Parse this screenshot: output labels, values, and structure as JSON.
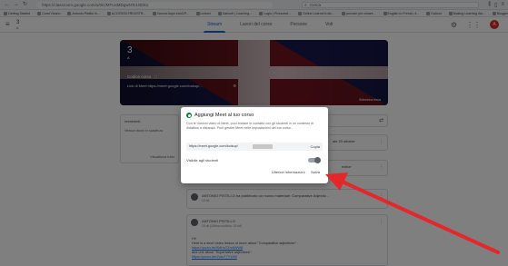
{
  "browser": {
    "url": "https://classroom.google.com/u/0/c/MTUxMDgwNTc1ODk1",
    "search_placeholder": "Cerca",
    "bookmarks": [
      "Getting Started",
      "Corsi Vicario",
      "Antonio Pistillo in...",
      "ACCESSO REGISTR...",
      "Nuova Aspo eduGP...",
      "Lezioni",
      "Kahoot! | Learning...",
      "Login | Pronuncit...",
      "Online Learner's dic...",
      "provare per creare...",
      "English to French, it...",
      "Kahoot",
      "Making Learning Aw...",
      "Blogger: Prof. Pisti..."
    ]
  },
  "classroom": {
    "menu_icon": "hamburger-menu-icon",
    "course_num": "3",
    "course_sub": "A",
    "tabs": [
      "Stream",
      "Lavori del corso",
      "Persone",
      "Voti"
    ],
    "active_tab": "Stream",
    "avatar_letter": "A"
  },
  "banner": {
    "title": "3",
    "subtitle": "A",
    "code_label": "Codice corso",
    "meet_label": "Link di Meet  https://meet.google.com/lookup/...",
    "edit_label": "Seleziona tema"
  },
  "side_card": {
    "title": "Imminenti",
    "sub": "Nessun lavoro in scadenza",
    "link": "Visualizza tutto"
  },
  "posts": [
    {
      "title": "",
      "date": "",
      "right_text": "ale 20 ottobre"
    },
    {
      "title": "",
      "date": "",
      "right_text": "ective"
    },
    {
      "title": "ANTONIO PISTILLO ha pubblicato un nuovo materiale: Comparative Adjectiv...",
      "date": "15 ott"
    },
    {
      "title": "ANTONIO PISTILLO",
      "date": "15 ott (Ultima modifica: 15 ott)",
      "body": [
        "Hi!",
        "Here is a short video lesson of more about \"Comparative adjectives\":",
        "https://youtu.be/9MHsTZm6WW8",
        "and one about \"Superlative adjectives\":",
        "https://youtu.be/1VavT7Y1fIM"
      ]
    }
  ],
  "dialog": {
    "title": "Aggiungi Meet al tuo corso",
    "description": "Con le riunioni video di Meet, puoi entrare in contatto con gli studenti in un contesto di didattica a distanza. Puoi gestire Meet nelle impostazioni del tuo corso.",
    "meet_link": "https://meet.google.com/lookup/",
    "copy_label": "Copia",
    "visible_label": "Visibile agli studenti",
    "visible_state": true,
    "more_info_label": "Ulteriori informazioni",
    "save_label": "Salva"
  },
  "colors": {
    "accent": "#1967d2",
    "meet_green": "#00832d",
    "arrow_red": "#e5262a"
  }
}
